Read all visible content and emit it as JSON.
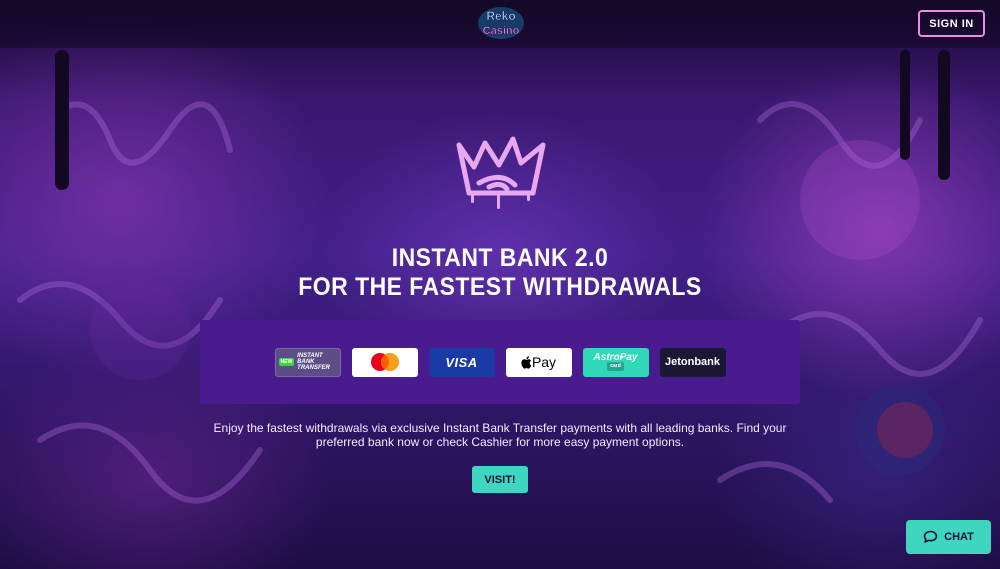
{
  "header": {
    "logo_text": "Reko Casino",
    "signin_label": "SIGN IN"
  },
  "hero": {
    "title_line1": "INSTANT BANK 2.0",
    "title_line2": "FOR THE FASTEST WITHDRAWALS",
    "description": "Enjoy the fastest withdrawals via exclusive Instant Bank Transfer payments with all leading banks. Find your preferred bank now or check Cashier for more easy payment options.",
    "visit_label": "VISIT!"
  },
  "payments": [
    {
      "name": "instant-bank-transfer",
      "tag": "NEW",
      "label_line1": "INSTANT",
      "label_line2": "BANK TRANSFER"
    },
    {
      "name": "mastercard",
      "label": ""
    },
    {
      "name": "visa",
      "label": "VISA"
    },
    {
      "name": "apple-pay",
      "label": "Pay"
    },
    {
      "name": "astropay",
      "label": "AstroPay",
      "sub": "card"
    },
    {
      "name": "jetonbank",
      "label": "Jetonbank"
    }
  ],
  "chat": {
    "label": "CHAT"
  },
  "colors": {
    "accent_teal": "#3fd6c0",
    "signin_border": "#e98de0",
    "panel": "#4a1b8f"
  }
}
